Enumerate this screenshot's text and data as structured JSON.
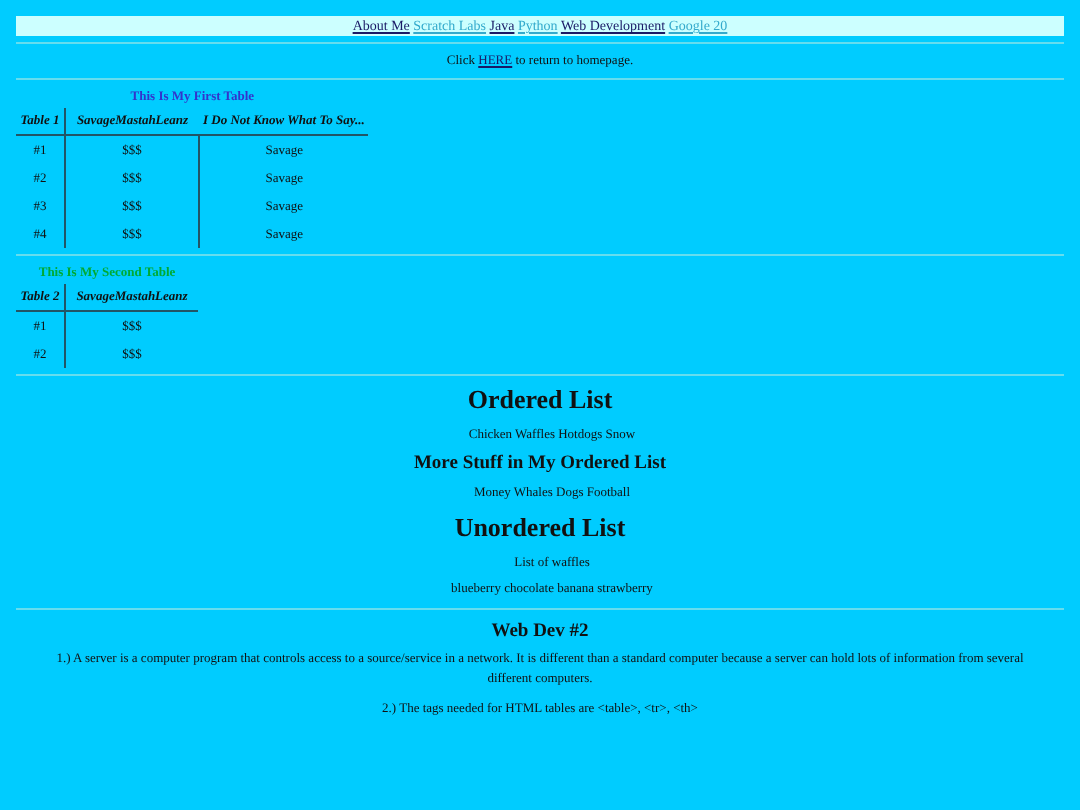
{
  "nav": {
    "links": [
      {
        "label": "About Me",
        "visited": false
      },
      {
        "label": "Scratch Labs",
        "visited": true
      },
      {
        "label": "Java",
        "visited": false
      },
      {
        "label": "Python",
        "visited": true
      },
      {
        "label": "Web Development",
        "visited": false
      },
      {
        "label": "Google 20",
        "visited": true
      }
    ]
  },
  "home": {
    "before": "Click",
    "link": "HERE",
    "after": "to return to homepage."
  },
  "tables": [
    {
      "caption": "This Is My First Table",
      "color": "#3333cc",
      "columns": [
        "Table 1",
        "SavageMastahLeanz",
        "I Do Not Know What To Say..."
      ],
      "rows": [
        [
          "#1",
          "$$$",
          "Savage"
        ],
        [
          "#2",
          "$$$",
          "Savage"
        ],
        [
          "#3",
          "$$$",
          "Savage"
        ],
        [
          "#4",
          "$$$",
          "Savage"
        ]
      ]
    },
    {
      "caption": "This Is My Second Table",
      "color": "#00aa33",
      "columns": [
        "Table 2",
        "SavageMastahLeanz"
      ],
      "rows": [
        [
          "#1",
          "$$$"
        ],
        [
          "#2",
          "$$$"
        ]
      ]
    }
  ],
  "lists": [
    {
      "heading": "Ordered List",
      "kind": "large",
      "text": "Chicken Waffles Hotdogs Snow"
    },
    {
      "heading": "More Stuff in My Ordered List",
      "kind": "medium",
      "text": "Money Whales Dogs Football"
    },
    {
      "heading": "Unordered List",
      "kind": "large",
      "text": "List of waffles"
    }
  ],
  "unordered_items": "blueberry chocolate banana strawberry",
  "webdev": {
    "heading": "Web Dev #2",
    "paragraphs": [
      "1.) A server is a computer program that controls access to a source/service in a network. It is different than a standard computer because a server can hold lots of information from several different computers.",
      "2.) The tags needed for HTML tables are <table>, <tr>, <th>"
    ]
  }
}
